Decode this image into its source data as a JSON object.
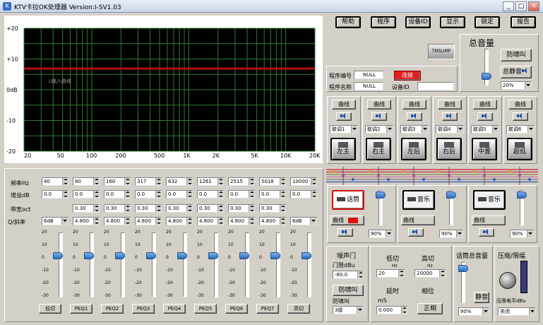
{
  "window": {
    "title": "KTV卡拉OK处理器  Version:I-SV1.03",
    "min": "_",
    "max": "□",
    "close": "✕"
  },
  "top_buttons": [
    "帮助",
    "程序",
    "设备ID",
    "显示",
    "锁定",
    "报告"
  ],
  "graph": {
    "y_labels": [
      "+20",
      "+10",
      "0dB",
      "-10",
      "-20"
    ],
    "x_labels": [
      "20",
      "50",
      "100",
      "200",
      "500",
      "1K",
      "2K",
      "5K",
      "10K",
      "20K"
    ],
    "curve_text": "L输入曲线"
  },
  "device": {
    "program_no_label": "程序编号",
    "program_no": "NULL",
    "program_name_label": "程序名称",
    "program_name": "NULL",
    "connect": "连接",
    "device_id_label": "设备ID",
    "device_id": ""
  },
  "master": {
    "title": "总音量",
    "anti_howl": "防啸叫",
    "mute": "总静音",
    "percent": "20%",
    "logo": "TMSLIMP"
  },
  "channels": [
    {
      "curve": "曲线",
      "link": "联调1",
      "name": "左主"
    },
    {
      "curve": "曲线",
      "link": "联调2",
      "name": "右主"
    },
    {
      "curve": "曲线",
      "link": "联调3",
      "name": "左后"
    },
    {
      "curve": "曲线",
      "link": "联调4",
      "name": "右后"
    },
    {
      "curve": "曲线",
      "link": "联调5",
      "name": "中置"
    },
    {
      "curve": "曲线",
      "link": "联调6",
      "name": "超低"
    }
  ],
  "eq": {
    "freq_label": "频率Hz",
    "gain_label": "增益dB",
    "bw_label": "带宽oct",
    "q_label": "Q/斜率",
    "freq": [
      "40",
      "80",
      "160",
      "317",
      "632",
      "1261",
      "2515",
      "5018",
      "10000"
    ],
    "gain": [
      "0.0",
      "0.0",
      "0.0",
      "0.0",
      "0.0",
      "0.0",
      "0.0",
      "0.0",
      "0.0"
    ],
    "bw": [
      "",
      "0.30",
      "0.30",
      "0.30",
      "0.30",
      "0.30",
      "0.30",
      "0.30",
      ""
    ],
    "q": [
      "6dB",
      "4.800",
      "4.800",
      "4.800",
      "4.800",
      "4.800",
      "4.800",
      "4.800",
      "6dB"
    ],
    "scale": [
      "20",
      "10",
      "0",
      "-10",
      "-20",
      "-30"
    ],
    "bands": [
      "低切",
      "PEQ1",
      "PEQ2",
      "PEQ3",
      "PEQ4",
      "PEQ5",
      "PEQ6",
      "PEQ7",
      "高切"
    ]
  },
  "inputs": [
    {
      "name": "话筒",
      "label": "曲线",
      "percent": "90%",
      "active": true
    },
    {
      "name": "音乐",
      "label": "曲线",
      "percent": "90%",
      "active": false
    },
    {
      "name": "音乐",
      "label": "曲线",
      "percent": "90%",
      "active": false
    }
  ],
  "noise_gate": {
    "title": "噪声门",
    "threshold_label": "门限dBu",
    "threshold": "-80.0",
    "anti_howl": "防啸叫",
    "howl_label": "防啸叫",
    "level": "3级"
  },
  "crossover": {
    "low_label": "低切",
    "high_label": "高切",
    "hz": "Hz",
    "low": "20",
    "high": "20000",
    "delay_label": "延时",
    "phase_label": "相位",
    "ms": "mS",
    "delay": "0.000",
    "phase": "正相"
  },
  "mic_master": {
    "title": "话筒总音量",
    "mute": "静音",
    "percent": "90%"
  },
  "compressor": {
    "title": "压缩/限幅",
    "knob_label": "压限电平dBu",
    "mode": "关闭"
  }
}
